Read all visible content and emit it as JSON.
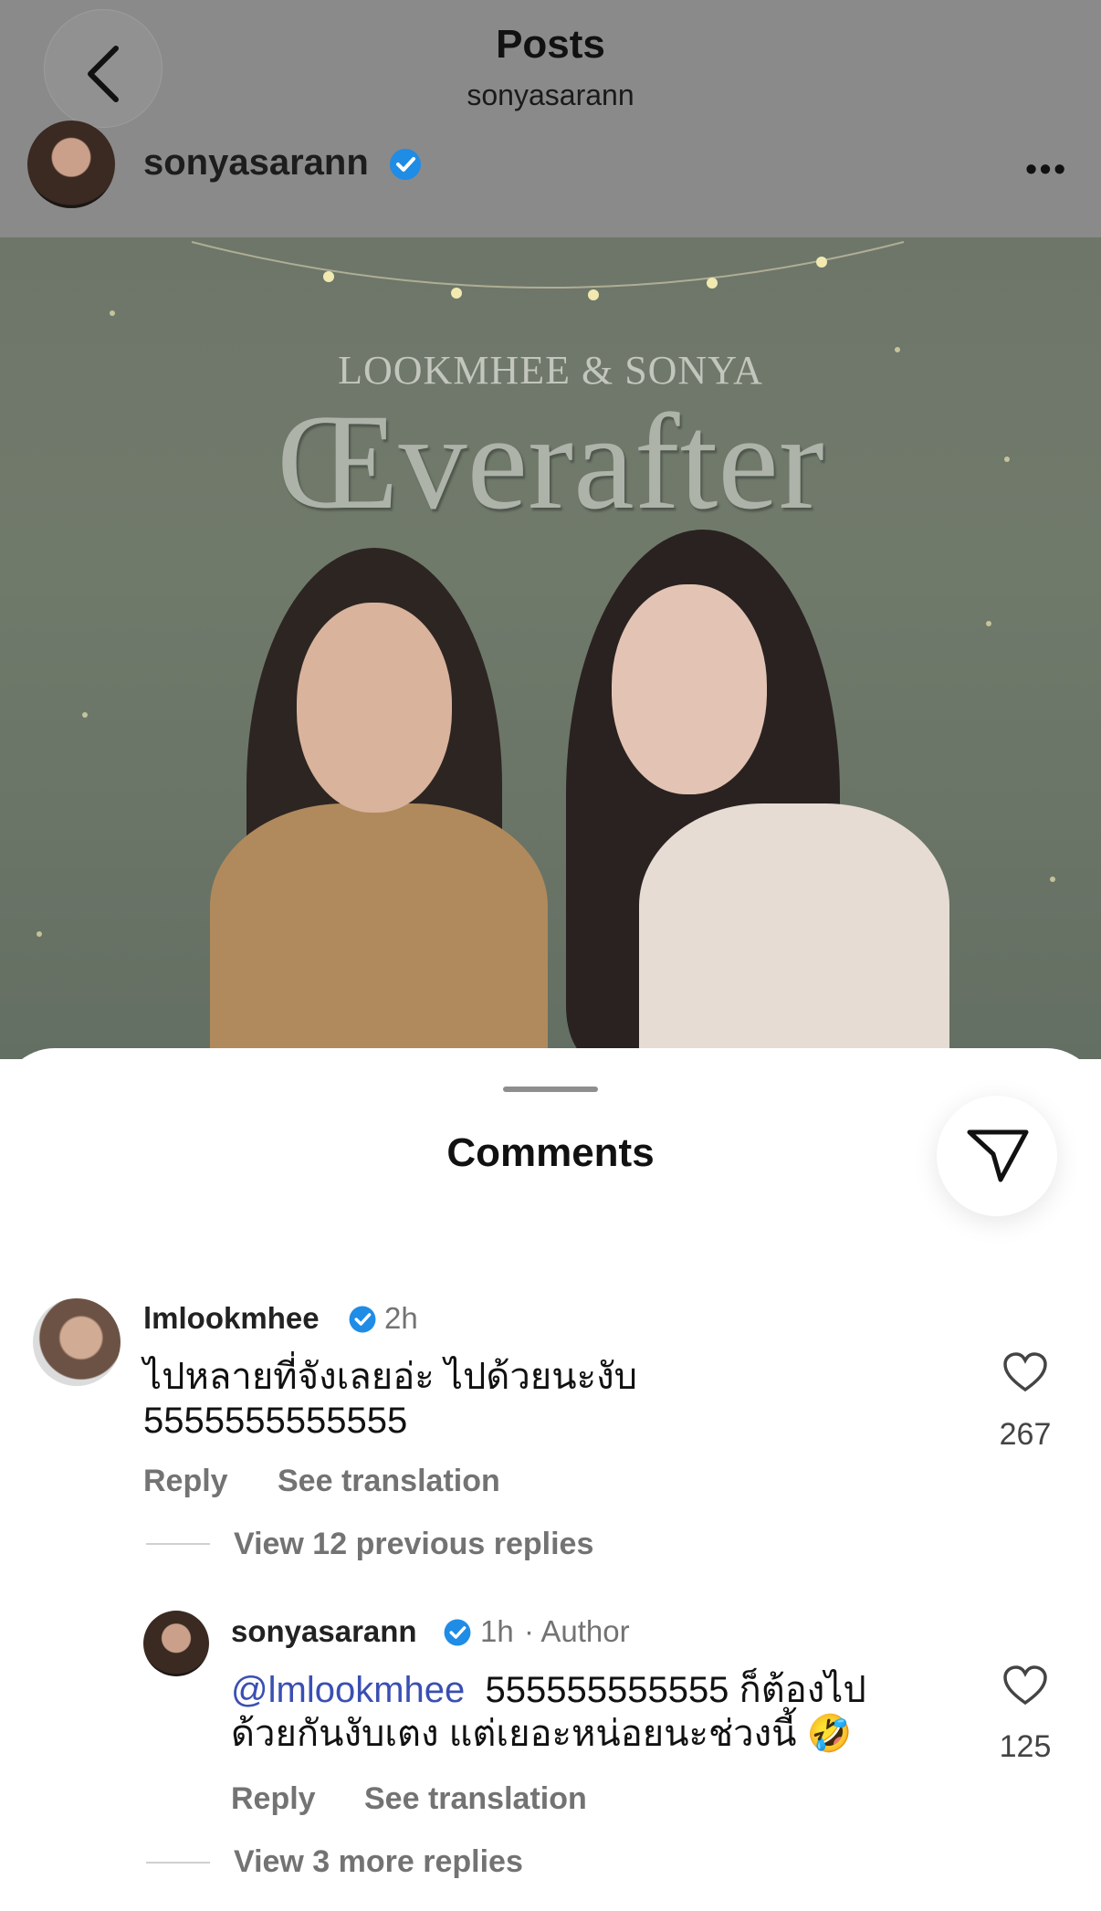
{
  "header": {
    "title": "Posts",
    "subtitle": "sonyasarann",
    "author": "sonyasarann",
    "more": "•••"
  },
  "post": {
    "lead_text": "LOOKMHEE & SONYA",
    "title": "Œverafter"
  },
  "comments_sheet": {
    "title": "Comments",
    "comments": [
      {
        "username": "lmlookmhee",
        "verified": true,
        "time": "2h",
        "text_line1": "ไปหลายที่จังเลยอ่ะ ไปด้วยนะงับ",
        "text_line2": "5555555555555",
        "reply": "Reply",
        "see_translation": "See translation",
        "likes": "267",
        "view_replies": "View 12 previous replies"
      },
      {
        "username": "sonyasarann",
        "verified": true,
        "time": "1h",
        "author_tag": "· Author",
        "mention": "@lmlookmhee",
        "text_line1": "  555555555555 ก็ต้องไป",
        "text_line2": "ด้วยกันงับเตง  แต่เยอะหน่อยนะช่วงนี้ 🤣",
        "reply": "Reply",
        "see_translation": "See translation",
        "likes": "125",
        "view_replies": "View 3 more replies"
      }
    ]
  },
  "colors": {
    "verified_blue": "#1f8ce6",
    "mention_blue": "#3a4fb3",
    "muted_gray": "#737373"
  },
  "icons": [
    "back-icon",
    "verified-icon",
    "more-icon",
    "send-icon",
    "heart-icon"
  ]
}
